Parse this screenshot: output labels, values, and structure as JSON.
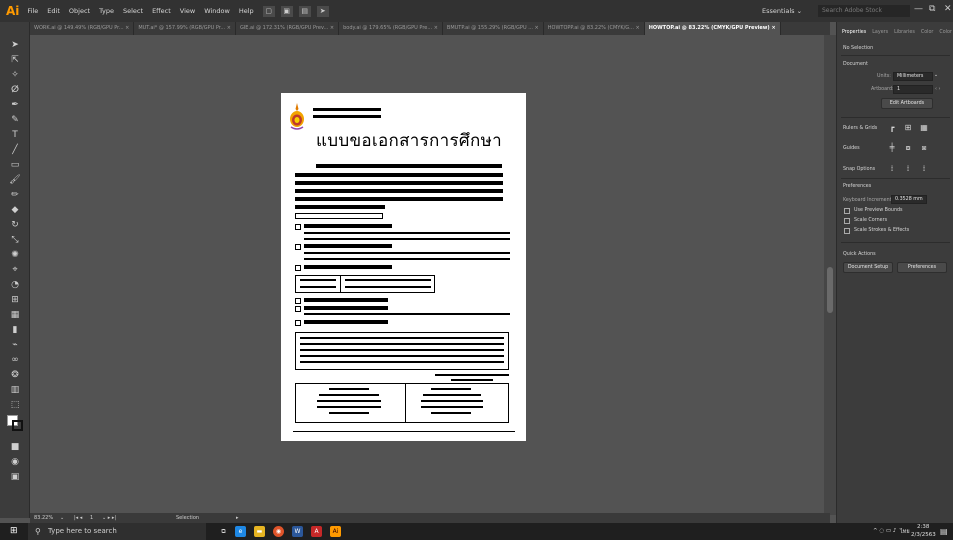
{
  "app": {
    "logo": "Ai",
    "menu": [
      "File",
      "Edit",
      "Object",
      "Type",
      "Select",
      "Effect",
      "View",
      "Window",
      "Help"
    ],
    "workspace": "Essentials",
    "stock_search_placeholder": "Search Adobe Stock",
    "window_controls": {
      "minimize": "—",
      "restore": "⧉",
      "close": "✕"
    }
  },
  "tabs": [
    {
      "label": "WORK.ai @ 149.49% (RGB/GPU Pr...  ×"
    },
    {
      "label": "MUT.ai* @ 157.99% (RGB/GPU Pr...  ×"
    },
    {
      "label": "GIE.ai @ 172.31% (RGB/GPU Prev...  ×"
    },
    {
      "label": "body.ai @ 179.65% (RGB/GPU Pre...  ×"
    },
    {
      "label": "BMUTP.ai @ 155.29% (RGB/GPU ...  ×"
    },
    {
      "label": "HOWTOPP.ai @ 83.22% (CMYK/G...  ×"
    },
    {
      "label": "HOWTOP.ai @ 83.22% (CMYK/GPU Preview)  ×",
      "active": true
    }
  ],
  "document": {
    "title": "แบบขอเอกสารการศึกษา"
  },
  "status": {
    "zoom": "83.22%",
    "artboard_nav": "1",
    "tool": "Selection"
  },
  "panel": {
    "tabs": [
      "Properties",
      "Layers",
      "Libraries",
      "Color",
      "Color"
    ],
    "active_tab": "Properties",
    "no_selection": "No Selection",
    "document_heading": "Document",
    "units_label": "Units:",
    "units_value": "Millimeters",
    "artboard_label": "Artboard:",
    "artboard_value": "1",
    "edit_artboards": "Edit Artboards",
    "rulers_grids": "Rulers & Grids",
    "guides": "Guides",
    "snap_options": "Snap Options",
    "preferences_heading": "Preferences",
    "keyboard_increment_label": "Keyboard Increment:",
    "keyboard_increment_value": "0.3528 mm",
    "use_preview_bounds": "Use Preview Bounds",
    "scale_corners": "Scale Corners",
    "scale_strokes": "Scale Strokes & Effects",
    "quick_actions": "Quick Actions",
    "document_setup": "Document Setup",
    "preferences_button": "Preferences"
  },
  "taskbar": {
    "search_placeholder": "Type here to search",
    "time": "2:38",
    "date": "2/3/2563",
    "lang": "ไทย"
  }
}
